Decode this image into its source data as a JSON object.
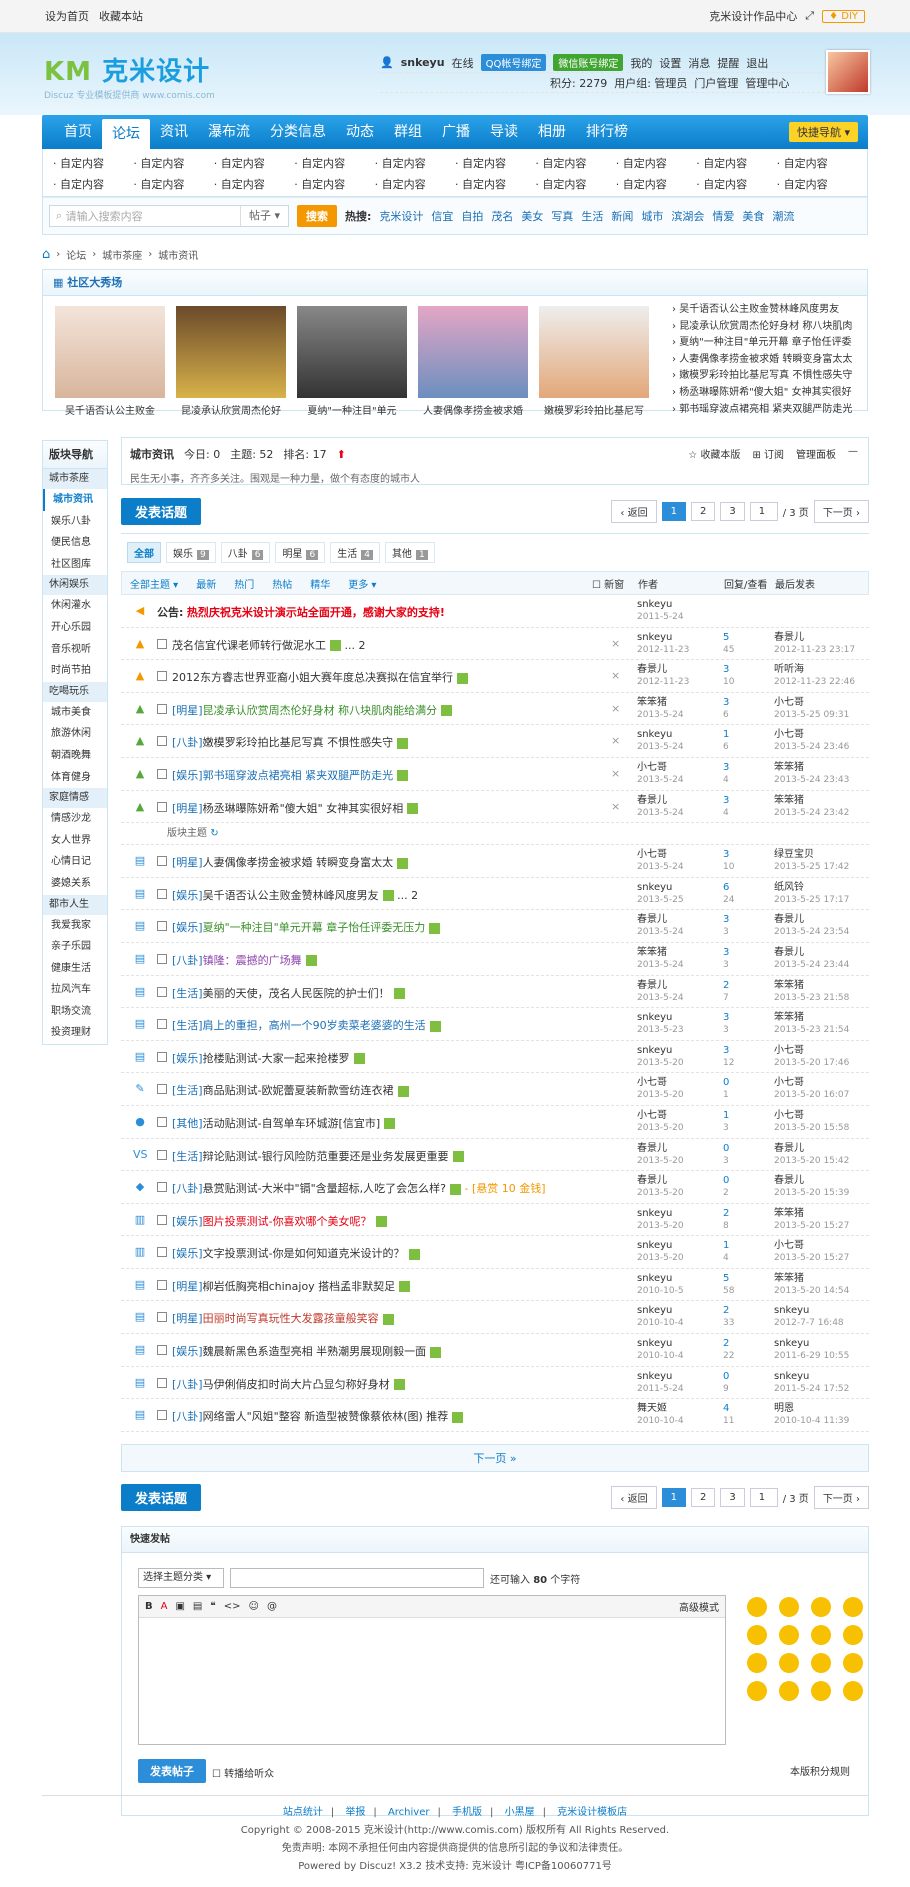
{
  "topbar": {
    "left1": "设为首页",
    "left2": "收藏本站",
    "right1": "克米设计作品中心",
    "diy": "♦ DIY"
  },
  "logo": {
    "main": "克米设计",
    "sub": "Discuz 专业模板提供商 www.comis.com"
  },
  "user": {
    "name": "snkeyu",
    "online": "在线",
    "qq": "QQ帐号绑定",
    "wx": "微信账号绑定",
    "mine": "我的",
    "settings": "设置",
    "msg": "消息",
    "remind": "提醒",
    "logout": "退出",
    "credit": "积分: 2279",
    "group": "用户组: 管理员",
    "portal": "门户管理",
    "admin": "管理中心"
  },
  "nav": {
    "items": [
      "首页",
      "论坛",
      "资讯",
      "瀑布流",
      "分类信息",
      "动态",
      "群组",
      "广播",
      "导读",
      "相册",
      "排行榜"
    ],
    "quick": "快捷导航 ▾"
  },
  "subnav": [
    "自定内容",
    "自定内容",
    "自定内容",
    "自定内容",
    "自定内容",
    "自定内容",
    "自定内容",
    "自定内容",
    "自定内容",
    "自定内容",
    "自定内容",
    "自定内容",
    "自定内容",
    "自定内容",
    "自定内容",
    "自定内容",
    "自定内容",
    "自定内容",
    "自定内容",
    "自定内容"
  ],
  "search": {
    "placeholder": "请输入搜索内容",
    "type": "帖子 ▾",
    "button": "搜索",
    "hot_label": "热搜:",
    "hot": [
      "克米设计",
      "信宜",
      "自拍",
      "茂名",
      "美女",
      "写真",
      "生活",
      "新闻",
      "城市",
      "滨湖会",
      "情爱",
      "美食",
      "潮流"
    ]
  },
  "crumb": [
    "论坛",
    "城市茶座",
    "城市资讯"
  ],
  "show": {
    "title": "社区大秀场",
    "pics": [
      "吴千语否认公主败金",
      "昆凌承认欣赏周杰伦好",
      "夏纳\"一种注目\"单元",
      "人妻偶像孝捞金被求婚",
      "嫩模罗彩玲拍比基尼写"
    ],
    "list": [
      "吴千语否认公主败金赞林峰风度男友",
      "昆凌承认欣赏周杰伦好身材 称八块肌肉",
      "夏纳\"一种注目\"单元开幕 章子怡任评委",
      "人妻偶像孝捞金被求婚 转瞬变身富太太",
      "嫩模罗彩玲拍比基尼写真 不惧性感失守",
      "杨丞琳曝陈妍希\"傻大姐\" 女神其实很好",
      "郭书瑶穿波点裙亮相 紧夹双腿严防走光"
    ]
  },
  "side": {
    "header": "版块导航",
    "groups": [
      {
        "name": "城市茶座",
        "items": [
          "城市资讯",
          "娱乐八卦",
          "便民信息",
          "社区图库"
        ]
      },
      {
        "name": "休闲娱乐",
        "items": [
          "休闲灌水",
          "开心乐园",
          "音乐视听",
          "时尚节拍"
        ]
      },
      {
        "name": "吃喝玩乐",
        "items": [
          "城市美食",
          "旅游休闲",
          "朝酒晚舞",
          "体育健身"
        ]
      },
      {
        "name": "家庭情感",
        "items": [
          "情感沙龙",
          "女人世界",
          "心情日记",
          "婆媳关系"
        ]
      },
      {
        "name": "都市人生",
        "items": [
          "我爱我家",
          "亲子乐园",
          "健康生活",
          "拉风汽车",
          "职场交流",
          "投资理财"
        ]
      }
    ]
  },
  "forum": {
    "name": "城市资讯",
    "today": "今日: 0",
    "topics": "主题: 52",
    "rank": "排名: 17",
    "fav": "收藏本版",
    "rss": "订阅",
    "manage": "管理面板",
    "desc": "民生无小事，齐齐多关注。围观是一种力量，做个有态度的城市人"
  },
  "post_btn": "发表话题",
  "pager": {
    "prev": "‹ 返回",
    "p1": "1",
    "p2": "2",
    "p3": "3",
    "input": "1",
    "total": "/ 3 页",
    "next": "下一页 ›"
  },
  "tabs": [
    {
      "label": "全部",
      "n": ""
    },
    {
      "label": "娱乐",
      "n": "9"
    },
    {
      "label": "八卦",
      "n": "6"
    },
    {
      "label": "明星",
      "n": "6"
    },
    {
      "label": "生活",
      "n": "4"
    },
    {
      "label": "其他",
      "n": "1"
    }
  ],
  "lhead": {
    "filters": [
      "全部主题 ▾",
      "最新",
      "热门",
      "热帖",
      "精华",
      "更多 ▾"
    ],
    "newwin": "新窗",
    "author": "作者",
    "reply": "回复/查看",
    "last": "最后发表"
  },
  "announce": {
    "label": "公告:",
    "text": "热烈庆祝克米设计演示站全面开通，感谢大家的支持!",
    "author": "snkeyu",
    "date": "2011-5-24"
  },
  "top_threads": [
    {
      "icon": "▲",
      "tag": "",
      "title": "茂名信宜代课老师转行做泥水工",
      "extra": " ... 2",
      "au": "snkeyu",
      "ad": "2012-11-23",
      "r": "5",
      "v": "45",
      "la": "春景儿",
      "ld": "2012-11-23 23:17"
    },
    {
      "icon": "▲",
      "tag": "",
      "title": "2012东方睿志世界亚裔小姐大赛年度总决赛拟在信宜举行",
      "extra": "",
      "au": "春景儿",
      "ad": "2012-11-23",
      "r": "3",
      "v": "10",
      "la": "听听海",
      "ld": "2012-11-23 22:46"
    },
    {
      "icon": "▲",
      "tag": "[明星]",
      "title": "昆凌承认欣赏周杰伦好身材 称八块肌肉能给满分",
      "extra": "",
      "au": "笨笨猪",
      "ad": "2013-5-24",
      "r": "3",
      "v": "6",
      "la": "小七哥",
      "ld": "2013-5-25 09:31"
    },
    {
      "icon": "▲",
      "tag": "[八卦]",
      "title": "嫩模罗彩玲拍比基尼写真 不惧性感失守",
      "extra": "",
      "au": "snkeyu",
      "ad": "2013-5-24",
      "r": "1",
      "v": "6",
      "la": "小七哥",
      "ld": "2013-5-24 23:46"
    },
    {
      "icon": "▲",
      "tag": "[娱乐]",
      "title": "郭书瑶穿波点裙亮相 紧夹双腿严防走光",
      "extra": "",
      "au": "小七哥",
      "ad": "2013-5-24",
      "r": "3",
      "v": "4",
      "la": "笨笨猪",
      "ld": "2013-5-24 23:43"
    },
    {
      "icon": "▲",
      "tag": "[明星]",
      "title": "杨丞琳曝陈妍希\"傻大姐\" 女神其实很好相",
      "extra": "",
      "au": "春景儿",
      "ad": "2013-5-24",
      "r": "3",
      "v": "4",
      "la": "笨笨猪",
      "ld": "2013-5-24 23:42"
    }
  ],
  "sep": "版块主题",
  "threads": [
    {
      "icon": "▤",
      "tag": "[明星]",
      "title": "人妻偶像孝捞金被求婚 转瞬变身富太太",
      "extra": "",
      "au": "小七哥",
      "ad": "2013-5-24",
      "r": "3",
      "v": "10",
      "la": "绿豆宝贝",
      "ld": "2013-5-25 17:42"
    },
    {
      "icon": "▤",
      "tag": "[娱乐]",
      "title": "吴千语否认公主败金赞林峰风度男友",
      "extra": " ... 2",
      "au": "snkeyu",
      "ad": "2013-5-25",
      "r": "6",
      "v": "24",
      "la": "纸风铃",
      "ld": "2013-5-25 17:17"
    },
    {
      "icon": "▤",
      "tag": "[娱乐]",
      "title": "夏纳\"一种注目\"单元开幕 章子怡任评委无压力",
      "extra": "",
      "au": "春景儿",
      "ad": "2013-5-24",
      "r": "3",
      "v": "3",
      "la": "春景儿",
      "ld": "2013-5-24 23:54"
    },
    {
      "icon": "▤",
      "tag": "[八卦]",
      "title": "镇隆：震撼的广场舞",
      "extra": "",
      "au": "笨笨猪",
      "ad": "2013-5-24",
      "r": "3",
      "v": "3",
      "la": "春景儿",
      "ld": "2013-5-24 23:44"
    },
    {
      "icon": "▤",
      "tag": "[生活]",
      "title": "美丽的天使，茂名人民医院的护士们！",
      "extra": "",
      "au": "春景儿",
      "ad": "2013-5-24",
      "r": "2",
      "v": "7",
      "la": "笨笨猪",
      "ld": "2013-5-23 21:58"
    },
    {
      "icon": "▤",
      "tag": "[生活]",
      "title": "肩上的重担，高州一个90岁卖菜老婆婆的生活",
      "extra": "",
      "au": "snkeyu",
      "ad": "2013-5-23",
      "r": "3",
      "v": "3",
      "la": "笨笨猪",
      "ld": "2013-5-23 21:54"
    },
    {
      "icon": "▤",
      "tag": "[娱乐]",
      "title": "抢楼贴测试-大家一起来抢楼罗",
      "extra": "",
      "au": "snkeyu",
      "ad": "2013-5-20",
      "r": "3",
      "v": "12",
      "la": "小七哥",
      "ld": "2013-5-20 17:46"
    },
    {
      "icon": "✎",
      "tag": "[生活]",
      "title": "商品贴测试-欧妮蕾夏装新款雪纺连衣裙",
      "extra": "",
      "au": "小七哥",
      "ad": "2013-5-20",
      "r": "0",
      "v": "1",
      "la": "小七哥",
      "ld": "2013-5-20 16:07"
    },
    {
      "icon": "●",
      "tag": "[其他]",
      "title": "活动贴测试-自驾单车环城游[信宜市]",
      "extra": "",
      "au": "小七哥",
      "ad": "2013-5-20",
      "r": "1",
      "v": "3",
      "la": "小七哥",
      "ld": "2013-5-20 15:58"
    },
    {
      "icon": "VS",
      "tag": "[生活]",
      "title": "辩论贴测试-银行风险防范重要还是业务发展更重要",
      "extra": "",
      "au": "春景儿",
      "ad": "2013-5-20",
      "r": "0",
      "v": "3",
      "la": "春景儿",
      "ld": "2013-5-20 15:42"
    },
    {
      "icon": "◆",
      "tag": "[八卦]",
      "title": "悬赏贴测试-大米中\"镉\"含量超标,人吃了会怎么样?",
      "extra": " - [悬赏 10 金钱]",
      "au": "春景儿",
      "ad": "2013-5-20",
      "r": "0",
      "v": "2",
      "la": "春景儿",
      "ld": "2013-5-20 15:39"
    },
    {
      "icon": "▥",
      "tag": "[娱乐]",
      "title": "图片投票测试-你喜欢哪个美女呢？",
      "extra": "",
      "au": "snkeyu",
      "ad": "2013-5-20",
      "r": "2",
      "v": "8",
      "la": "笨笨猪",
      "ld": "2013-5-20 15:27"
    },
    {
      "icon": "▥",
      "tag": "[娱乐]",
      "title": "文字投票测试-你是如何知道克米设计的？",
      "extra": "",
      "au": "snkeyu",
      "ad": "2013-5-20",
      "r": "1",
      "v": "4",
      "la": "小七哥",
      "ld": "2013-5-20 15:27"
    },
    {
      "icon": "▤",
      "tag": "[明星]",
      "title": "柳岩低胸亮相chinajoy 搭档孟非默契足",
      "extra": "",
      "au": "snkeyu",
      "ad": "2010-10-5",
      "r": "5",
      "v": "58",
      "la": "笨笨猪",
      "ld": "2013-5-20 14:54"
    },
    {
      "icon": "▤",
      "tag": "[明星]",
      "title": "田丽时尚写真玩性大发露孩童般笑容",
      "extra": "",
      "au": "snkeyu",
      "ad": "2010-10-4",
      "r": "2",
      "v": "33",
      "la": "snkeyu",
      "ld": "2012-7-7 16:48"
    },
    {
      "icon": "▤",
      "tag": "[娱乐]",
      "title": "魏晨新黑色系造型亮相 半熟潮男展现刚毅一面",
      "extra": "",
      "au": "snkeyu",
      "ad": "2010-10-4",
      "r": "2",
      "v": "22",
      "la": "snkeyu",
      "ld": "2011-6-29 10:55"
    },
    {
      "icon": "▤",
      "tag": "[八卦]",
      "title": "马伊俐俏皮扣时尚大片凸显匀称好身材",
      "extra": "",
      "au": "snkeyu",
      "ad": "2011-5-24",
      "r": "0",
      "v": "9",
      "la": "snkeyu",
      "ld": "2011-5-24 17:52"
    },
    {
      "icon": "▤",
      "tag": "[八卦]",
      "title": "网络雷人\"风姐\"整容 新造型被赞像蔡依林(图) 推荐",
      "extra": "",
      "au": "舞天姬",
      "ad": "2010-10-4",
      "r": "4",
      "v": "11",
      "la": "明恩",
      "ld": "2010-10-4 11:39"
    }
  ],
  "next_page": "下一页 »",
  "fastpost": {
    "title": "快速发帖",
    "select": "选择主题分类 ▾",
    "tip1": "还可输入",
    "tip_n": "80",
    "tip2": "个字符",
    "advanced": "高级模式",
    "tools": [
      "B",
      "A",
      "▣",
      "▤",
      "❝",
      "<>",
      "☺",
      "@"
    ],
    "submit": "发表帖子",
    "sync": "转播给听众",
    "rule": "本版积分规则"
  },
  "footer": {
    "links": [
      "站点统计",
      "举报",
      "Archiver",
      "手机版",
      "小黑屋",
      "克米设计模板店"
    ],
    "copy": "Copyright © 2008-2015 克米设计(http://www.comis.com) 版权所有 All Rights Reserved.",
    "disclaimer": "免责声明: 本网不承担任何由内容提供商提供的信息所引起的争议和法律责任。",
    "powered": "Powered by Discuz! X3.2  技术支持: 克米设计  粤ICP备10060771号"
  }
}
